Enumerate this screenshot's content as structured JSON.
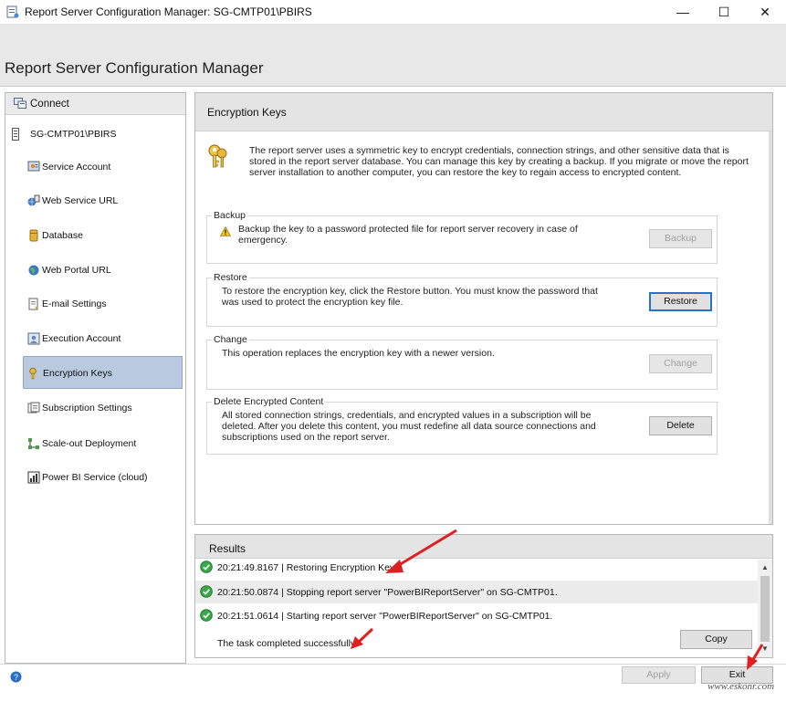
{
  "window": {
    "title": "Report Server Configuration Manager: SG-CMTP01\\PBIRS",
    "minimize": "—",
    "maximize": "☐",
    "close": "✕"
  },
  "app": {
    "heading": "Report Server Configuration Manager"
  },
  "sidebar": {
    "connect_label": "Connect",
    "server_label": "SG-CMTP01\\PBIRS",
    "items": [
      {
        "label": "Service Account",
        "icon": "service-account-icon"
      },
      {
        "label": "Web Service URL",
        "icon": "web-service-icon"
      },
      {
        "label": "Database",
        "icon": "database-icon"
      },
      {
        "label": "Web Portal URL",
        "icon": "globe-icon"
      },
      {
        "label": "E-mail Settings",
        "icon": "email-icon"
      },
      {
        "label": "Execution Account",
        "icon": "execution-account-icon"
      },
      {
        "label": "Encryption Keys",
        "icon": "key-icon",
        "selected": true
      },
      {
        "label": "Subscription Settings",
        "icon": "subscription-icon"
      },
      {
        "label": "Scale-out Deployment",
        "icon": "scale-out-icon"
      },
      {
        "label": "Power BI Service (cloud)",
        "icon": "power-bi-icon"
      }
    ]
  },
  "main": {
    "title": "Encryption Keys",
    "intro": "The report server uses a symmetric key to encrypt credentials, connection strings, and other sensitive data that is stored in the report server database.  You can manage this key by creating a backup.  If you migrate or move the report server installation to another computer, you can restore the key to regain access to encrypted content.",
    "groups": {
      "backup": {
        "title": "Backup",
        "text": "Backup the key to a password protected file for report server recovery in case of emergency.",
        "button": "Backup",
        "button_enabled": false
      },
      "restore": {
        "title": "Restore",
        "text": "To restore the encryption key, click the Restore button.  You must know the password that was used to protect the encryption key file.",
        "button": "Restore",
        "button_enabled": true
      },
      "change": {
        "title": "Change",
        "text": "This operation replaces the encryption key with a newer version.",
        "button": "Change",
        "button_enabled": false
      },
      "delete": {
        "title": "Delete Encrypted Content",
        "text": "All stored connection strings, credentials, and encrypted values in a subscription will be deleted.  After you delete this content, you must redefine all data source connections and subscriptions used on the report server.",
        "button": "Delete",
        "button_enabled": true
      }
    }
  },
  "results": {
    "title": "Results",
    "rows": [
      "20:21:49.8167 | Restoring Encryption Key",
      "20:21:50.0874 | Stopping report server \"PowerBIReportServer\" on SG-CMTP01.",
      "20:21:51.0614 | Starting report server \"PowerBIReportServer\" on SG-CMTP01."
    ],
    "status": "The task completed successfully.",
    "copy_button": "Copy"
  },
  "footer": {
    "apply": "Apply",
    "exit": "Exit",
    "watermark": "www.eskonr.com"
  },
  "colors": {
    "selected_bg": "#b9c9e0",
    "primary_border": "#2a72c8",
    "annotation_arrow": "#e02020",
    "success_green": "#2e9e3a"
  }
}
